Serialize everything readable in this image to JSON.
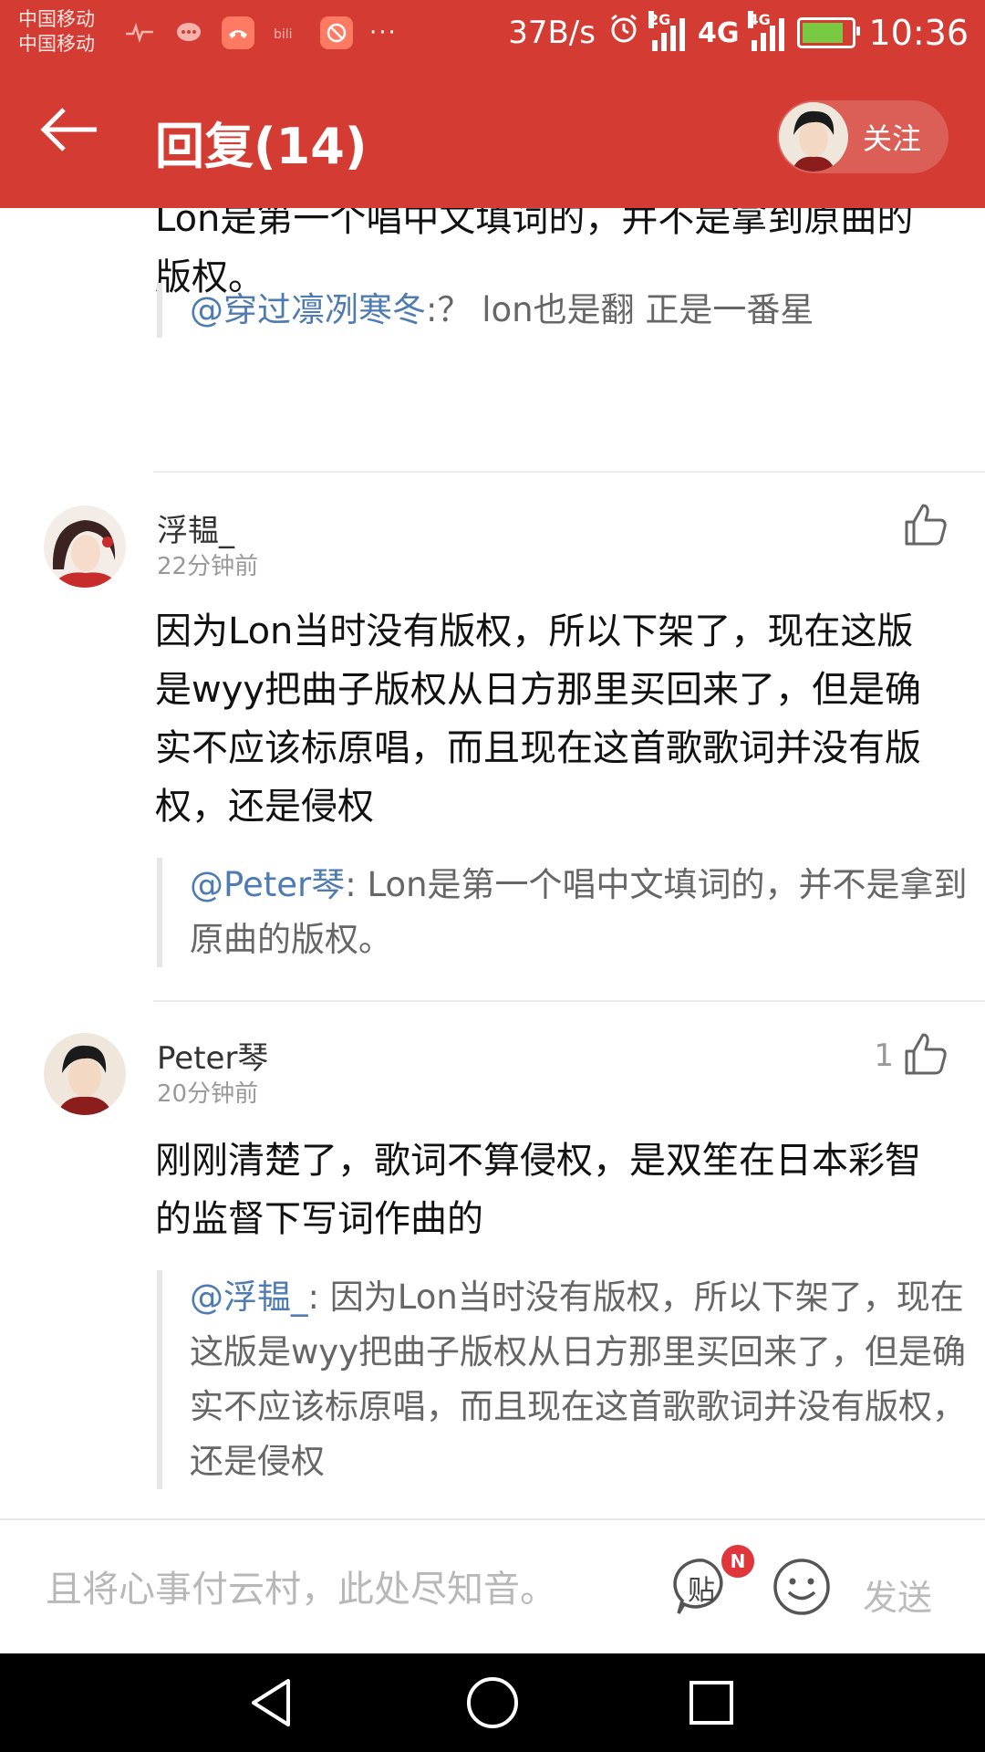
{
  "status_bar": {
    "carrier1": "中国移动",
    "carrier2": "中国移动",
    "speed": "37B/s",
    "net_2g": "2G",
    "net_4g": "4G",
    "net_4g_small": "4G",
    "time": "10:36",
    "app_icons": [
      "heart-rate-icon",
      "chat-bubble-icon",
      "phone-app-icon",
      "bilibili-icon",
      "target-app-icon"
    ],
    "more": "···"
  },
  "app_bar": {
    "title": "回复(14)",
    "follow_label": "关注"
  },
  "colors": {
    "primary": "#d43c33",
    "mention": "#4f7bb3",
    "badge": "#e0353a"
  },
  "top_fragment": {
    "text": "Lon是第一个唱中文填词的，并不是拿到原曲的版权。",
    "quote_mention": "@穿过凛冽寒冬",
    "quote_text": ":？ lon也是翻 正是一番星"
  },
  "comments": [
    {
      "username": "浮韫_",
      "time": "22分钟前",
      "likes": "",
      "text": "因为Lon当时没有版权，所以下架了，现在这版是wyy把曲子版权从日方那里买回来了，但是确实不应该标原唱，而且现在这首歌歌词并没有版权，还是侵权",
      "quote_mention": "@Peter琴",
      "quote_text": ": Lon是第一个唱中文填词的，并不是拿到原曲的版权。"
    },
    {
      "username": "Peter琴",
      "time": "20分钟前",
      "likes": "1",
      "text": "刚刚清楚了，歌词不算侵权，是双笙在日本彩智的监督下写词作曲的",
      "quote_mention": "@浮韫_",
      "quote_text": ": 因为Lon当时没有版权，所以下架了，现在这版是wyy把曲子版权从日方那里买回来了，但是确实不应该标原唱，而且现在这首歌歌词并没有版权，还是侵权"
    }
  ],
  "input_bar": {
    "placeholder": "且将心事付云村，此处尽知音。",
    "post_label": "贴",
    "badge": "N",
    "send_label": "发送"
  }
}
